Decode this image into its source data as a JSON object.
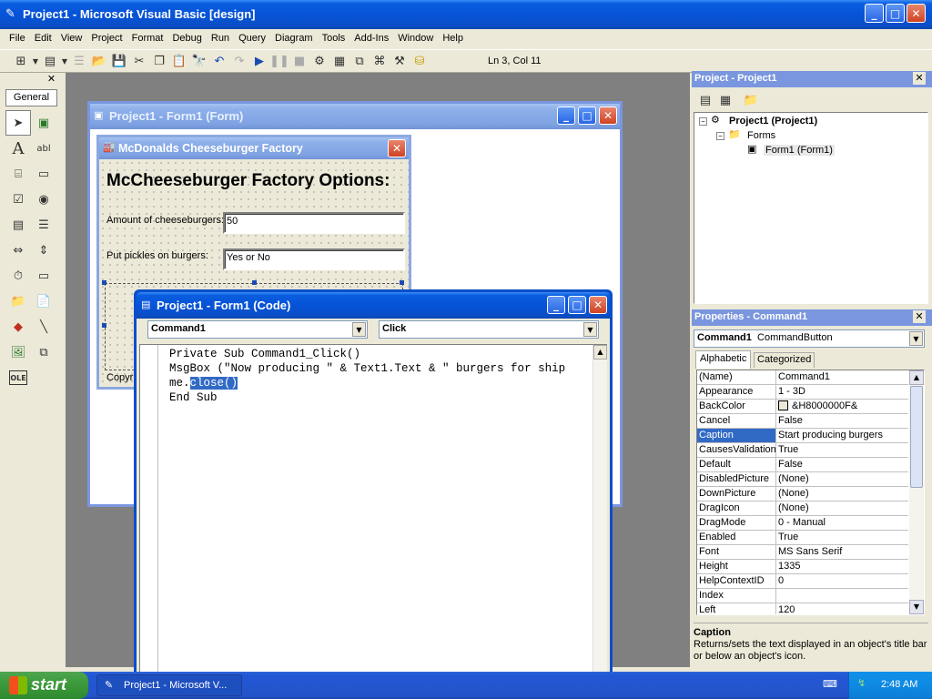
{
  "app": {
    "title": "Project1 - Microsoft Visual Basic [design]",
    "menu": [
      "File",
      "Edit",
      "View",
      "Project",
      "Format",
      "Debug",
      "Run",
      "Query",
      "Diagram",
      "Tools",
      "Add-Ins",
      "Window",
      "Help"
    ],
    "cursor_pos": "Ln 3, Col 11"
  },
  "toolbox": {
    "tab": "General",
    "tools": [
      "pointer-icon",
      "picture-box-icon",
      "label-icon",
      "textbox-icon",
      "frame-icon",
      "command-button-icon",
      "checkbox-icon",
      "option-button-icon",
      "combobox-icon",
      "listbox-icon",
      "hscroll-icon",
      "vscroll-icon",
      "timer-icon",
      "drive-list-icon",
      "dir-list-icon",
      "file-list-icon",
      "shape-icon",
      "line-icon",
      "image-icon",
      "data-icon",
      "ole-icon"
    ]
  },
  "form_designer": {
    "title": "Project1 - Form1 (Form)"
  },
  "mc_form": {
    "title": "McDonalds Cheeseburger Factory",
    "heading": "McCheeseburger Factory Options:",
    "amount_label": "Amount of cheeseburgers:",
    "amount_value": "50",
    "pickles_label": "Put pickles on burgers:",
    "pickles_value": "Yes or No",
    "footer_text": "Copyri"
  },
  "code_window": {
    "title": "Project1 - Form1 (Code)",
    "object_combo": "Command1",
    "proc_combo": "Click",
    "line1": "Private Sub Command1_Click()",
    "line2": "MsgBox (\"Now producing \" & Text1.Text & \" burgers for ship",
    "line3_prefix": "me.",
    "line3_selected": "close()",
    "line4": "End Sub"
  },
  "project_explorer": {
    "title": "Project - Project1",
    "root": "Project1 (Project1)",
    "folder": "Forms",
    "item": "Form1 (Form1)"
  },
  "properties": {
    "title": "Properties - Command1",
    "object_name": "Command1",
    "object_type": "CommandButton",
    "tab_alpha": "Alphabetic",
    "tab_cat": "Categorized",
    "rows": [
      {
        "name": "(Name)",
        "value": "Command1"
      },
      {
        "name": "Appearance",
        "value": "1 - 3D"
      },
      {
        "name": "BackColor",
        "value": "&H8000000F&"
      },
      {
        "name": "Cancel",
        "value": "False"
      },
      {
        "name": "Caption",
        "value": "Start producing burgers"
      },
      {
        "name": "CausesValidation",
        "value": "True"
      },
      {
        "name": "Default",
        "value": "False"
      },
      {
        "name": "DisabledPicture",
        "value": "(None)"
      },
      {
        "name": "DownPicture",
        "value": "(None)"
      },
      {
        "name": "DragIcon",
        "value": "(None)"
      },
      {
        "name": "DragMode",
        "value": "0 - Manual"
      },
      {
        "name": "Enabled",
        "value": "True"
      },
      {
        "name": "Font",
        "value": "MS Sans Serif"
      },
      {
        "name": "Height",
        "value": "1335"
      },
      {
        "name": "HelpContextID",
        "value": "0"
      },
      {
        "name": "Index",
        "value": ""
      },
      {
        "name": "Left",
        "value": "120"
      }
    ],
    "desc_title": "Caption",
    "desc_text": "Returns/sets the text displayed in an object's title bar or below an object's icon."
  },
  "taskbar": {
    "start": "start",
    "task": "Project1 - Microsoft V...",
    "clock": "2:48 AM"
  },
  "colors": {
    "xp_blue": "#0a5ddf",
    "mdi_bg": "#808080",
    "selection": "#316ac5",
    "start_green": "#3c9b3c"
  }
}
